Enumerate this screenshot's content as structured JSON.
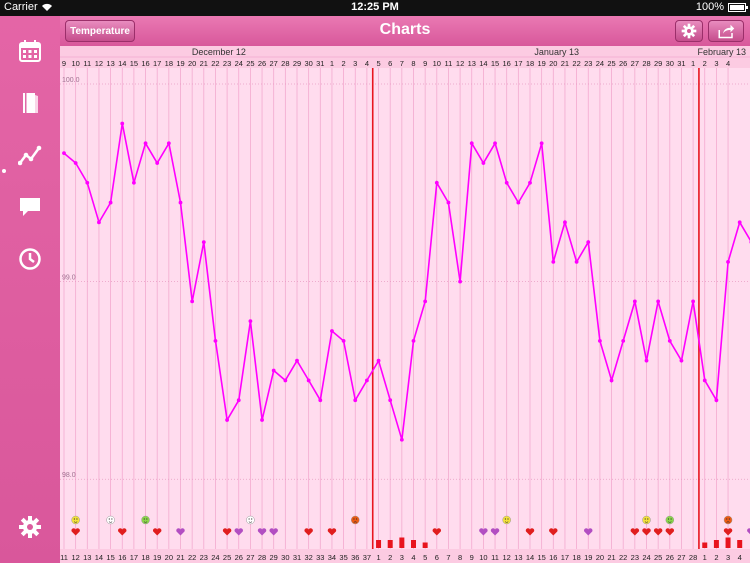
{
  "status_bar": {
    "carrier": "Carrier",
    "time": "12:25 PM",
    "battery": "100%"
  },
  "nav": {
    "title": "Charts",
    "mode_button": "Temperature"
  },
  "sidebar": {
    "items": [
      "calendar-icon",
      "notebook-icon",
      "chart-line-icon",
      "comment-icon",
      "clock-icon",
      "settings-icon"
    ],
    "active": "chart-line-icon"
  },
  "chart_data": {
    "type": "line",
    "months": [
      {
        "label": "December 12",
        "at_index": 9
      },
      {
        "label": "January 13",
        "at_index": 38
      },
      {
        "label": "February 13",
        "at_index": 56
      }
    ],
    "dates": [
      "9",
      "10",
      "11",
      "12",
      "13",
      "14",
      "15",
      "16",
      "17",
      "18",
      "19",
      "20",
      "21",
      "22",
      "23",
      "24",
      "25",
      "26",
      "27",
      "28",
      "29",
      "30",
      "31",
      "1",
      "2",
      "3",
      "4",
      "5",
      "6",
      "7",
      "8",
      "9",
      "10",
      "11",
      "12",
      "13",
      "14",
      "15",
      "16",
      "17",
      "18",
      "19",
      "20",
      "21",
      "22",
      "23",
      "24",
      "25",
      "26",
      "27",
      "28",
      "29",
      "30",
      "31",
      "1",
      "2",
      "3",
      "4"
    ],
    "cycle_days": [
      "11",
      "12",
      "13",
      "14",
      "15",
      "16",
      "17",
      "18",
      "19",
      "20",
      "21",
      "22",
      "23",
      "24",
      "25",
      "26",
      "27",
      "28",
      "29",
      "30",
      "31",
      "32",
      "33",
      "34",
      "35",
      "36",
      "37",
      "1",
      "2",
      "3",
      "4",
      "5",
      "6",
      "7",
      "8",
      "9",
      "10",
      "11",
      "12",
      "13",
      "14",
      "15",
      "16",
      "17",
      "18",
      "19",
      "20",
      "21",
      "22",
      "23",
      "24",
      "25",
      "26",
      "27",
      "28",
      "1",
      "2",
      "3",
      "4"
    ],
    "y_ticks": [
      "100.0",
      "99.0",
      "98.0"
    ],
    "ylim": [
      97.9,
      100.0
    ],
    "temperatures": [
      99.65,
      99.6,
      99.5,
      99.3,
      99.4,
      99.8,
      99.5,
      99.7,
      99.6,
      99.7,
      99.4,
      98.9,
      99.2,
      98.7,
      98.3,
      98.4,
      98.8,
      98.3,
      98.55,
      98.5,
      98.6,
      98.5,
      98.4,
      98.75,
      98.7,
      98.4,
      98.5,
      98.6,
      98.4,
      98.2,
      98.7,
      98.9,
      99.5,
      99.4,
      99.0,
      99.7,
      99.6,
      99.7,
      99.5,
      99.4,
      99.5,
      99.7,
      99.1,
      99.3,
      99.1,
      99.2,
      98.7,
      98.5,
      98.7,
      98.9,
      98.6,
      98.9,
      98.7,
      98.6,
      98.9,
      98.5,
      98.4,
      99.1,
      99.3,
      99.2
    ],
    "cycle_start_lines_at_index": [
      27,
      55
    ],
    "line_color": "#ff00ff",
    "cycle_line_color": "#e8141e",
    "markers": [
      {
        "index": 1,
        "mood": "happy",
        "heart": "red"
      },
      {
        "index": 4,
        "mood": "neutral"
      },
      {
        "index": 5,
        "heart": "red"
      },
      {
        "index": 7,
        "mood": "happy-green"
      },
      {
        "index": 8,
        "heart": "red"
      },
      {
        "index": 10,
        "heart": "purple"
      },
      {
        "index": 14,
        "heart": "red"
      },
      {
        "index": 15,
        "heart": "purple"
      },
      {
        "index": 16,
        "mood": "neutral"
      },
      {
        "index": 17,
        "heart": "purple"
      },
      {
        "index": 18,
        "heart": "purple"
      },
      {
        "index": 21,
        "heart": "red"
      },
      {
        "index": 23,
        "heart": "red"
      },
      {
        "index": 25,
        "mood": "angry"
      },
      {
        "index": 32,
        "heart": "red"
      },
      {
        "index": 36,
        "heart": "purple"
      },
      {
        "index": 37,
        "heart": "purple"
      },
      {
        "index": 38,
        "mood": "happy"
      },
      {
        "index": 40,
        "heart": "red"
      },
      {
        "index": 42,
        "heart": "red"
      },
      {
        "index": 45,
        "heart": "purple"
      },
      {
        "index": 49,
        "heart": "red"
      },
      {
        "index": 50,
        "mood": "happy",
        "heart": "red"
      },
      {
        "index": 51,
        "heart": "red"
      },
      {
        "index": 52,
        "mood": "happy-green",
        "heart": "red"
      },
      {
        "index": 57,
        "mood": "angry",
        "heart": "red"
      },
      {
        "index": 59,
        "heart": "purple"
      }
    ],
    "period_bars": [
      {
        "index": 27,
        "level": 2
      },
      {
        "index": 28,
        "level": 2
      },
      {
        "index": 29,
        "level": 3
      },
      {
        "index": 30,
        "level": 2
      },
      {
        "index": 31,
        "level": 1
      },
      {
        "index": 55,
        "level": 1
      },
      {
        "index": 56,
        "level": 2
      },
      {
        "index": 57,
        "level": 3
      },
      {
        "index": 58,
        "level": 2
      }
    ]
  }
}
